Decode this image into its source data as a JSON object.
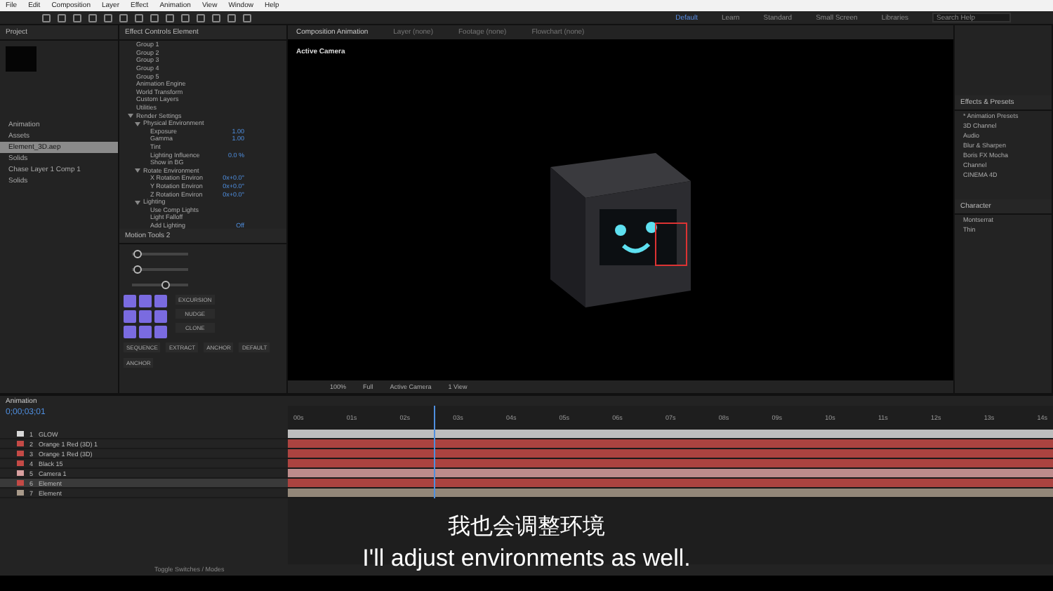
{
  "menu": [
    "File",
    "Edit",
    "Composition",
    "Layer",
    "Effect",
    "Animation",
    "View",
    "Window",
    "Help"
  ],
  "workspaces": [
    {
      "label": "Default",
      "selected": true
    },
    {
      "label": "Learn",
      "selected": false
    },
    {
      "label": "Standard",
      "selected": false
    },
    {
      "label": "Small Screen",
      "selected": false
    },
    {
      "label": "Libraries",
      "selected": false
    }
  ],
  "search": {
    "placeholder": "Search Help"
  },
  "project": {
    "title": "Project",
    "items": [
      {
        "name": "Animation",
        "selected": false
      },
      {
        "name": "Assets",
        "selected": false
      },
      {
        "name": "Element_3D.aep",
        "selected": true
      },
      {
        "name": "Solids",
        "selected": false
      },
      {
        "name": "Chase Layer 1 Comp 1",
        "selected": false
      },
      {
        "name": "Solids",
        "selected": false
      }
    ]
  },
  "effect_controls": {
    "title": "Effect Controls Element",
    "tree": [
      {
        "label": "Group 1"
      },
      {
        "label": "Group 2"
      },
      {
        "label": "Group 3"
      },
      {
        "label": "Group 4"
      },
      {
        "label": "Group 5"
      },
      {
        "label": "Animation Engine"
      },
      {
        "label": "World Transform"
      },
      {
        "label": "Custom Layers"
      },
      {
        "label": "Utilities"
      },
      {
        "label": "Render Settings",
        "children": [
          {
            "label": "Physical Environment",
            "children": [
              {
                "label": "Exposure",
                "value": "1.00"
              },
              {
                "label": "Gamma",
                "value": "1.00"
              },
              {
                "label": "Tint"
              },
              {
                "label": "Lighting Influence",
                "value": "0.0 %"
              },
              {
                "label": "Show in BG"
              }
            ]
          },
          {
            "label": "Rotate Environment",
            "children": [
              {
                "label": "X Rotation Environ",
                "value": "0x+0.0°"
              },
              {
                "label": "Y Rotation Environ",
                "value": "0x+0.0°"
              },
              {
                "label": "Z Rotation Environ",
                "value": "0x+0.0°"
              }
            ]
          },
          {
            "label": "Lighting",
            "children": [
              {
                "label": "Use Comp Lights"
              },
              {
                "label": "Light Falloff"
              },
              {
                "label": "Add Lighting",
                "value": "Off"
              }
            ]
          }
        ]
      }
    ]
  },
  "motion_tools": {
    "title": "Motion Tools 2",
    "buttons": [
      "EXCURSION",
      "NUDGE",
      "CLONE",
      "SEQUENCE",
      "EXTRACT",
      "ANCHOR",
      "DEFAULT",
      "ANCHOR"
    ],
    "sliders": [
      {
        "level": 0.1
      },
      {
        "level": 0.1
      },
      {
        "level": 0.6
      }
    ]
  },
  "viewer": {
    "tabs": [
      {
        "label": "Composition Animation",
        "selected": true
      },
      {
        "label": "Layer (none)",
        "selected": false
      },
      {
        "label": "Footage (none)",
        "selected": false
      },
      {
        "label": "Flowchart (none)",
        "selected": false
      }
    ],
    "label": "Active Camera",
    "zoom": "100%",
    "view": "Full",
    "camera": "Active Camera",
    "views": "1 View"
  },
  "effects_presets": {
    "title": "Effects & Presets",
    "items": [
      "* Animation Presets",
      "3D Channel",
      "Audio",
      "Blur & Sharpen",
      "Boris FX Mocha",
      "Channel",
      "CINEMA 4D"
    ]
  },
  "character": {
    "title": "Character",
    "font": "Montserrat",
    "style": "Thin"
  },
  "timeline": {
    "tab": "Animation",
    "time": "0;00;03;01",
    "ruler": [
      "00s",
      "01s",
      "02s",
      "03s",
      "04s",
      "05s",
      "06s",
      "07s",
      "08s",
      "09s",
      "10s",
      "11s",
      "12s",
      "13s",
      "14s"
    ],
    "layers": [
      {
        "num": "1",
        "name": "GLOW",
        "color": "#d9d9d9",
        "selected": false
      },
      {
        "num": "2",
        "name": "Orange 1 Red (3D) 1",
        "color": "#c44a46",
        "selected": false
      },
      {
        "num": "3",
        "name": "Orange 1 Red (3D)",
        "color": "#c44a46",
        "selected": false
      },
      {
        "num": "4",
        "name": "Black 15",
        "color": "#c44a46",
        "selected": false
      },
      {
        "num": "5",
        "name": "Camera 1",
        "color": "#d9a0a0",
        "selected": false
      },
      {
        "num": "6",
        "name": "Element",
        "color": "#c44a46",
        "selected": true
      },
      {
        "num": "7",
        "name": "Element",
        "color": "#a89a8a",
        "selected": false
      }
    ],
    "footer": "Toggle Switches / Modes"
  },
  "subtitles": [
    "我也会调整环境",
    "I'll adjust environments as well."
  ]
}
